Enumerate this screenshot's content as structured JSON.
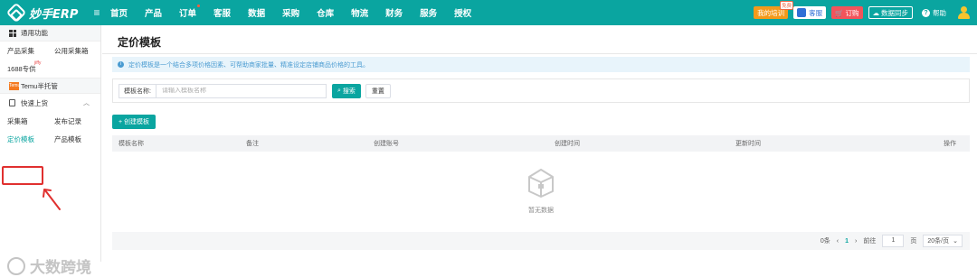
{
  "brand": {
    "name": "妙手ERP"
  },
  "nav": [
    "首页",
    "产品",
    "订单",
    "客服",
    "数据",
    "采购",
    "仓库",
    "物流",
    "财务",
    "服务",
    "授权"
  ],
  "top_right": {
    "training": "我的培训",
    "training_badge": "免费",
    "service": "客服",
    "order": "订购",
    "sync": "数据同步",
    "help": "帮助"
  },
  "sidebar": {
    "common": "通用功能",
    "row1": [
      "产品采集",
      "公用采集箱"
    ],
    "item_1688": "1688专供",
    "item_1688_sup": "jiffy",
    "temu_logo": "Temu",
    "temu": "Temu半托管",
    "quick": "快速上货",
    "row2": [
      "采集箱",
      "发布记录"
    ],
    "row3": [
      "定价模板",
      "产品模板"
    ]
  },
  "main": {
    "title": "定价模板",
    "info": "定价模板是一个结合多项价格因素、可帮助商家批量、精准设定店铺商品价格的工具。",
    "search_label": "模板名称:",
    "search_placeholder": "请输入模板名称",
    "search_btn": "搜索",
    "reset_btn": "重置",
    "create_btn": "+ 创建模板",
    "columns": [
      "模板名称",
      "备注",
      "创建账号",
      "创建时间",
      "更新时间",
      "操作"
    ],
    "empty": "暂无数据"
  },
  "pager": {
    "total": "0条",
    "prev": "‹",
    "page": "1",
    "next": "›",
    "goto": "前往",
    "page_input": "1",
    "page_unit": "页",
    "page_size": "20条/页"
  },
  "watermark": "大数跨境",
  "colors": {
    "primary": "#0aa5a0",
    "info": "#4a9bd1",
    "highlight": "#e0302f"
  }
}
